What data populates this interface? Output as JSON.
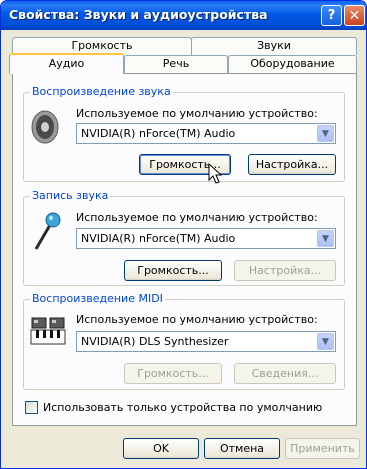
{
  "window": {
    "title": "Свойства: Звуки и аудиоустройства",
    "help_glyph": "?",
    "close_glyph": "✕"
  },
  "tabs": {
    "row_top": [
      "Громкость",
      "Звуки"
    ],
    "row_bottom": [
      "Аудио",
      "Речь",
      "Оборудование"
    ],
    "active": "Аудио"
  },
  "playback": {
    "group_label": "Воспроизведение звука",
    "device_label": "Используемое по умолчанию устройство:",
    "device_value": "NVIDIA(R) nForce(TM) Audio",
    "volume_button": "Громкость...",
    "settings_button": "Настройка...",
    "icon": "speaker-icon"
  },
  "recording": {
    "group_label": "Запись звука",
    "device_label": "Используемое по умолчанию устройство:",
    "device_value": "NVIDIA(R) nForce(TM) Audio",
    "volume_button": "Громкость...",
    "settings_button": "Настройка...",
    "icon": "microphone-icon"
  },
  "midi": {
    "group_label": "Воспроизведение MIDI",
    "device_label": "Используемое по умолчанию устройство:",
    "device_value": "NVIDIA(R) DLS Synthesizer",
    "volume_button": "Громкость...",
    "info_button": "Сведения...",
    "icon": "midi-keyboard-icon"
  },
  "default_only_checkbox": {
    "label": "Использовать только устройства по умолчанию",
    "checked": false
  },
  "footer": {
    "ok": "OK",
    "cancel": "Отмена",
    "apply": "Применить"
  },
  "colors": {
    "titlebar": "#0058e6",
    "group_label": "#0046d5",
    "active_tab_accent": "#ffc83c"
  }
}
